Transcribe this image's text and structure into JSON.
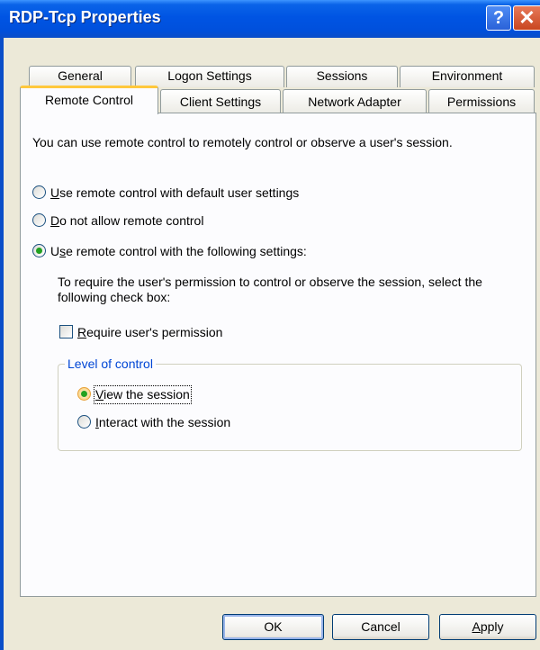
{
  "window": {
    "title": "RDP-Tcp Properties",
    "help_glyph": "?",
    "close_glyph": "✕"
  },
  "tabs": {
    "row1": [
      "General",
      "Logon Settings",
      "Sessions",
      "Environment"
    ],
    "row2": [
      "Remote Control",
      "Client Settings",
      "Network Adapter",
      "Permissions"
    ],
    "active": "Remote Control"
  },
  "panel": {
    "intro": "You can use remote control to remotely control or observe a user's session.",
    "options": [
      {
        "u": "U",
        "rest": "se remote control with default user settings",
        "checked": false
      },
      {
        "u": "D",
        "rest": "o not allow remote control",
        "checked": false
      },
      {
        "pre": "U",
        "u": "s",
        "rest": "e remote control with the following settings:",
        "checked": true
      }
    ],
    "permission_text": "To require the user's permission to control or observe the session, select the following check box:",
    "require_permission": {
      "u": "R",
      "rest": "equire user's permission",
      "checked": false
    },
    "level_of_control": {
      "legend": "Level of control",
      "options": [
        {
          "u": "V",
          "rest": "iew the session",
          "checked": true
        },
        {
          "u": "I",
          "rest": "nteract with the session",
          "checked": false
        }
      ]
    }
  },
  "buttons": {
    "ok": "OK",
    "cancel": "Cancel",
    "apply_u": "A",
    "apply_rest": "pply"
  },
  "colors": {
    "title_bar": "#0054e3",
    "active_tab_highlight": "#ffc83c",
    "group_legend": "#0046d5",
    "radio_dot": "#21a121"
  }
}
